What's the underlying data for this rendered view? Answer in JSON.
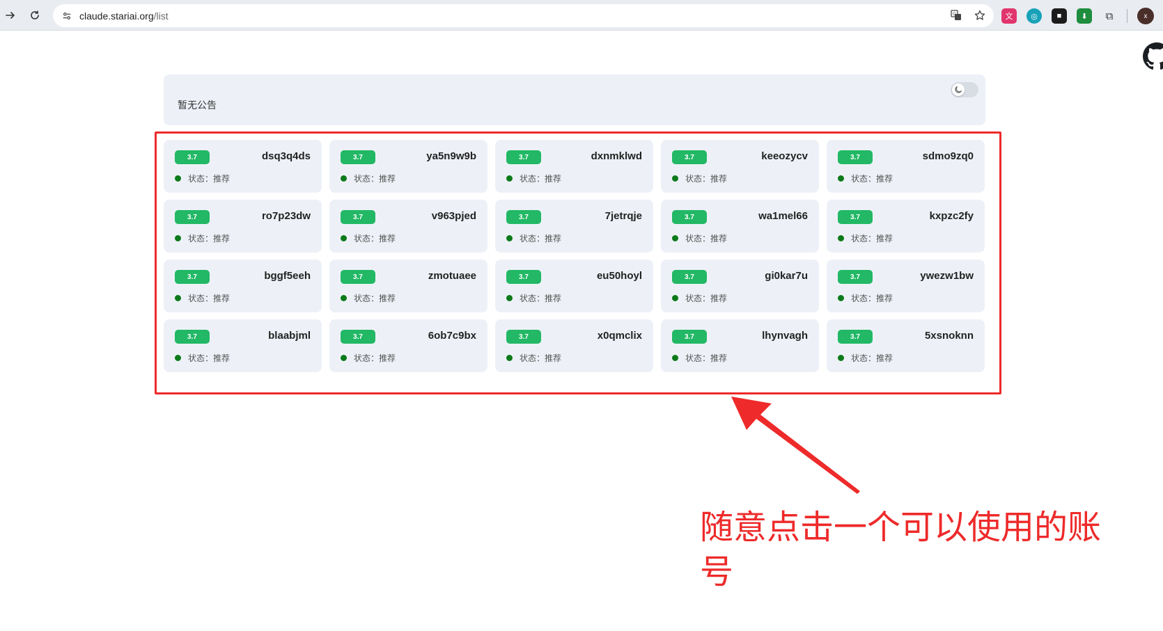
{
  "browser": {
    "url_host": "claude.stariai.org",
    "url_path": "/list",
    "profile_initial": "x"
  },
  "notice": {
    "text": "暂无公告"
  },
  "colors": {
    "badge": "#22b865",
    "status_dot": "#0c7a1a",
    "annotation": "#ee2a2a"
  },
  "accounts": [
    {
      "version": "3.7",
      "name": "dsq3q4ds",
      "status_label": "状态：",
      "status": "推荐"
    },
    {
      "version": "3.7",
      "name": "ya5n9w9b",
      "status_label": "状态：",
      "status": "推荐"
    },
    {
      "version": "3.7",
      "name": "dxnmklwd",
      "status_label": "状态：",
      "status": "推荐"
    },
    {
      "version": "3.7",
      "name": "keeozycv",
      "status_label": "状态：",
      "status": "推荐"
    },
    {
      "version": "3.7",
      "name": "sdmo9zq0",
      "status_label": "状态：",
      "status": "推荐"
    },
    {
      "version": "3.7",
      "name": "ro7p23dw",
      "status_label": "状态：",
      "status": "推荐"
    },
    {
      "version": "3.7",
      "name": "v963pjed",
      "status_label": "状态：",
      "status": "推荐"
    },
    {
      "version": "3.7",
      "name": "7jetrqje",
      "status_label": "状态：",
      "status": "推荐"
    },
    {
      "version": "3.7",
      "name": "wa1mel66",
      "status_label": "状态：",
      "status": "推荐"
    },
    {
      "version": "3.7",
      "name": "kxpzc2fy",
      "status_label": "状态：",
      "status": "推荐"
    },
    {
      "version": "3.7",
      "name": "bggf5eeh",
      "status_label": "状态：",
      "status": "推荐"
    },
    {
      "version": "3.7",
      "name": "zmotuaee",
      "status_label": "状态：",
      "status": "推荐"
    },
    {
      "version": "3.7",
      "name": "eu50hoyl",
      "status_label": "状态：",
      "status": "推荐"
    },
    {
      "version": "3.7",
      "name": "gi0kar7u",
      "status_label": "状态：",
      "status": "推荐"
    },
    {
      "version": "3.7",
      "name": "ywezw1bw",
      "status_label": "状态：",
      "status": "推荐"
    },
    {
      "version": "3.7",
      "name": "blaabjml",
      "status_label": "状态：",
      "status": "推荐"
    },
    {
      "version": "3.7",
      "name": "6ob7c9bx",
      "status_label": "状态：",
      "status": "推荐"
    },
    {
      "version": "3.7",
      "name": "x0qmclix",
      "status_label": "状态：",
      "status": "推荐"
    },
    {
      "version": "3.7",
      "name": "lhynvagh",
      "status_label": "状态：",
      "status": "推荐"
    },
    {
      "version": "3.7",
      "name": "5xsnoknn",
      "status_label": "状态：",
      "status": "推荐"
    }
  ],
  "annotation": {
    "text": "随意点击一个可以使用的账号"
  },
  "icons": {
    "forward": "forward-arrow-icon",
    "reload": "reload-icon",
    "site_info": "site-info-icon",
    "translate": "translate-icon",
    "bookmark": "star-icon",
    "github": "github-icon",
    "theme": "moon-icon"
  }
}
